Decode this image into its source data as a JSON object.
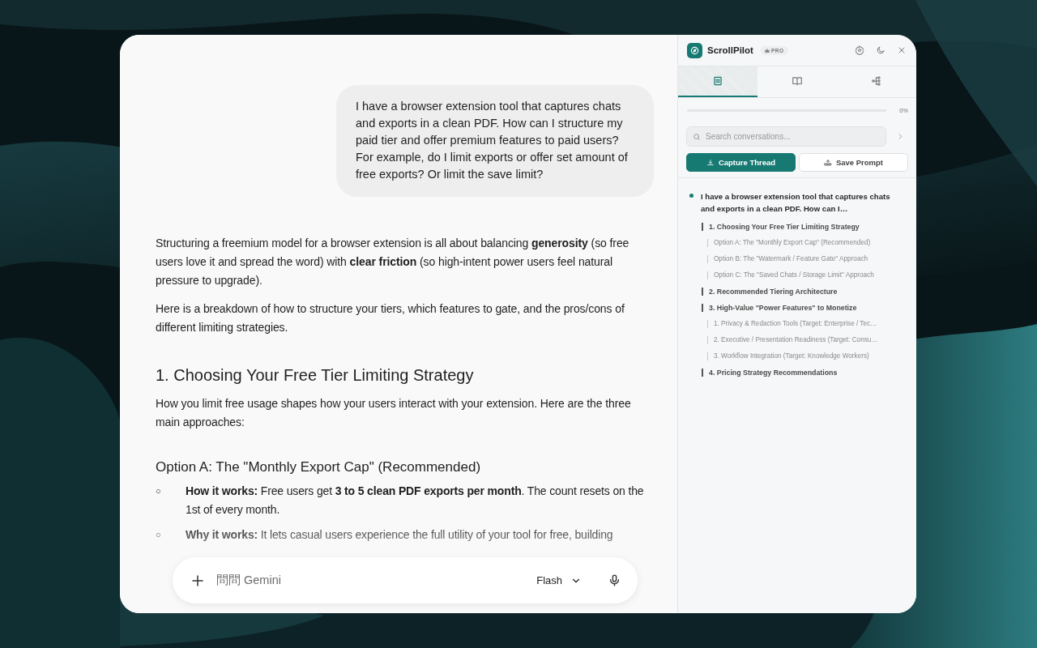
{
  "chat": {
    "user_message": "I have a browser extension tool that captures chats and exports in a clean PDF. How can I structure my paid tier and offer premium features to paid users? For example, do I limit exports or offer set amount of free exports? Or limit the save limit?",
    "response": [
      {
        "kind": "paragraph",
        "text": "Structuring a freemium model for a browser extension is all about balancing **generosity** (so free users love it and spread the word) with **clear friction** (so high-intent power users feel natural pressure to upgrade)."
      },
      {
        "kind": "paragraph",
        "text": "Here is a breakdown of how to structure your tiers, which features to gate, and the pros/cons of different limiting strategies."
      },
      {
        "kind": "heading",
        "text": "1. Choosing Your Free Tier Limiting Strategy"
      },
      {
        "kind": "paragraph",
        "text": "How you limit free usage shapes how your users interact with your extension. Here are the three main approaches:"
      },
      {
        "kind": "subheading",
        "text": "Option A: The \"Monthly Export Cap\" (Recommended)"
      },
      {
        "kind": "bullet",
        "marker": "○",
        "text": "**How it works:** Free users get **3 to 5 clean PDF exports per month**. The count resets on the 1st of every month."
      },
      {
        "kind": "bullet",
        "marker": "○",
        "text": "**Why it works:** It lets casual users experience the full utility of your tool for free, building"
      }
    ]
  },
  "composer": {
    "placeholder": "問問 Gemini",
    "model": "Flash"
  },
  "sidebar": {
    "app_name": "ScrollPilot",
    "badge": "PRO",
    "tabs": [
      {
        "kind": "outline",
        "selected": true
      },
      {
        "kind": "library",
        "selected": false
      },
      {
        "kind": "graph",
        "selected": false
      }
    ],
    "progress": {
      "level": 0,
      "reading": "0%"
    },
    "search": {
      "placeholder": "Search conversations..."
    },
    "buttons": [
      {
        "kind": "primary",
        "label": "Capture Thread"
      },
      {
        "kind": "secondary",
        "label": "Save Prompt"
      }
    ],
    "outline": {
      "text": "I have a browser extension tool that captures chats and exports in a clean PDF. How can I…",
      "children": [
        {
          "text": "1. Choosing Your Free Tier Limiting Strategy",
          "children": [
            {
              "text": "Option A: The \"Monthly Export Cap\" (Recommended)"
            },
            {
              "text": "Option B: The \"Watermark / Feature Gate\" Approach"
            },
            {
              "text": "Option C: The \"Saved Chats / Storage Limit\" Approach"
            }
          ]
        },
        {
          "text": "2. Recommended Tiering Architecture"
        },
        {
          "text": "3. High-Value \"Power Features\" to Monetize",
          "children": [
            {
              "text": "1. Privacy & Redaction Tools (Target: Enterprise / Tec…"
            },
            {
              "text": "2. Executive / Presentation Readiness (Target: Consu…"
            },
            {
              "text": "3. Workflow Integration (Target: Knowledge Workers)"
            }
          ]
        },
        {
          "text": "4. Pricing Strategy Recommendations"
        }
      ]
    }
  }
}
